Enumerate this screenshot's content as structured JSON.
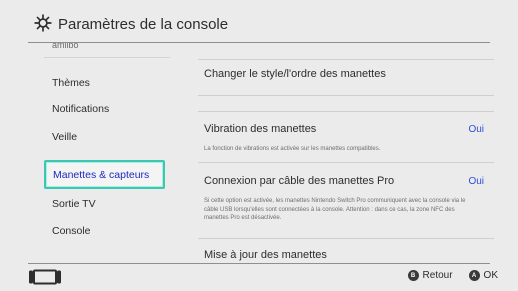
{
  "header": {
    "title": "Paramètres de la console"
  },
  "sidebar": {
    "clipped_item": "amiibo",
    "items": [
      {
        "label": "Thèmes"
      },
      {
        "label": "Notifications"
      },
      {
        "label": "Veille"
      },
      {
        "label": "Manettes & capteurs"
      },
      {
        "label": "Sortie TV"
      },
      {
        "label": "Console"
      }
    ]
  },
  "content": {
    "rows": [
      {
        "title": "Changer le style/l'ordre des manettes"
      },
      {
        "title": "Vibration des manettes",
        "value": "Oui",
        "desc": "La fonction de vibrations est activée sur les manettes compatibles."
      },
      {
        "title": "Connexion par câble des manettes Pro",
        "value": "Oui",
        "desc": "Si cette option est activée, les manettes Nintendo Switch Pro communiquent avec la console via le câble USB lorsqu'elles sont connectées à la console. Attention : dans ce cas, la zone NFC des manettes Pro est désactivée."
      },
      {
        "title": "Mise à jour des manettes"
      }
    ]
  },
  "footer": {
    "back_button_glyph": "B",
    "back_label": "Retour",
    "ok_button_glyph": "A",
    "ok_label": "OK"
  },
  "colors": {
    "accent": "#3cc7b3",
    "selected_text": "#1b2bbf",
    "value_blue": "#2e4fdd"
  }
}
